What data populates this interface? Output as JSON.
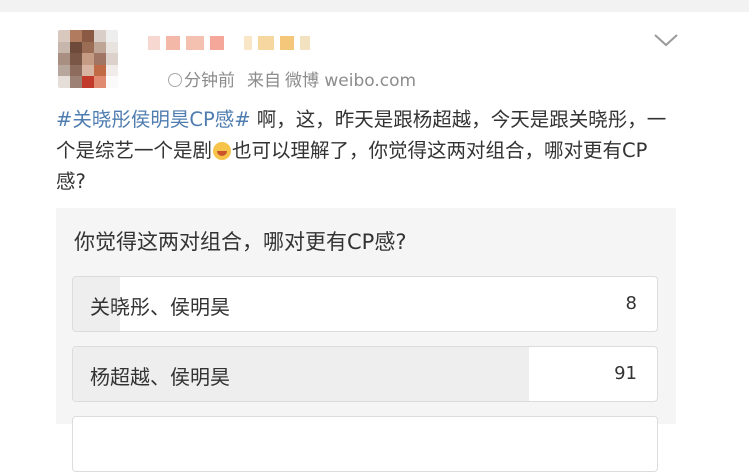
{
  "post": {
    "hashtag": "#关晓彤侯明昊CP感#",
    "text_part1": " 啊，这，昨天是跟杨超越，今天是跟关晓彤，一个是综艺一个是剧",
    "text_part2": "也可以理解了，你觉得这两对组合，哪对更有CP感?",
    "emoji_icon": "laugh-cry-emoji"
  },
  "meta": {
    "time": "分钟前",
    "source_prefix": "来自",
    "source": "微博 weibo.com"
  },
  "poll": {
    "question": "你觉得这两对组合，哪对更有CP感?",
    "options": [
      {
        "label": "关晓彤、侯明昊",
        "count": "8",
        "fraction": 0.08
      },
      {
        "label": "杨超越、侯明昊",
        "count": "91",
        "fraction": 0.78
      }
    ]
  },
  "colors": {
    "hashtag": "#4f7db0",
    "meta_text": "#8c8c8c",
    "poll_bg": "#f5f5f5"
  }
}
